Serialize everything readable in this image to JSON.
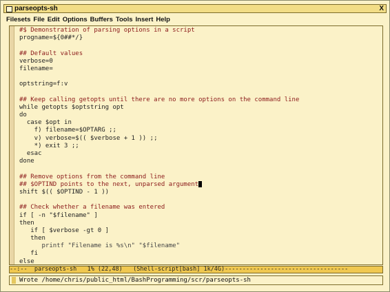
{
  "window": {
    "title": "parseopts-sh",
    "close_label": "X"
  },
  "menu": [
    "Filesets",
    "File",
    "Edit",
    "Options",
    "Buffers",
    "Tools",
    "Insert",
    "Help"
  ],
  "code_lines": [
    [
      {
        "t": "#$ Demonstration of parsing options in a script",
        "c": "cmt"
      }
    ],
    [
      {
        "t": "progname=${0##*/}",
        "c": ""
      }
    ],
    [
      {
        "t": "",
        "c": ""
      }
    ],
    [
      {
        "t": "## Default values",
        "c": "cmt"
      }
    ],
    [
      {
        "t": "verbose=0",
        "c": ""
      }
    ],
    [
      {
        "t": "filename=",
        "c": ""
      }
    ],
    [
      {
        "t": "",
        "c": ""
      }
    ],
    [
      {
        "t": "optstring=f:v",
        "c": ""
      }
    ],
    [
      {
        "t": "",
        "c": ""
      }
    ],
    [
      {
        "t": "## Keep calling getopts until there are no more options on the command line",
        "c": "cmt"
      }
    ],
    [
      {
        "t": "while getopts $optstring opt",
        "c": ""
      }
    ],
    [
      {
        "t": "do",
        "c": ""
      }
    ],
    [
      {
        "t": "  case $opt in",
        "c": ""
      }
    ],
    [
      {
        "t": "    f) filename=$OPTARG ;;",
        "c": ""
      }
    ],
    [
      {
        "t": "    v) verbose=$(( $verbose + 1 )) ;;",
        "c": ""
      }
    ],
    [
      {
        "t": "    *) exit 3 ;;",
        "c": ""
      }
    ],
    [
      {
        "t": "  esac",
        "c": ""
      }
    ],
    [
      {
        "t": "done",
        "c": ""
      }
    ],
    [
      {
        "t": "",
        "c": ""
      }
    ],
    [
      {
        "t": "## Remove options from the command line",
        "c": "cmt"
      }
    ],
    [
      {
        "t": "## $OPTIND points to the next, unparsed argument",
        "c": "cmt"
      }
    ],
    [
      {
        "t": "shift $(( $OPTIND - 1 ))",
        "c": ""
      }
    ],
    [
      {
        "t": "",
        "c": ""
      }
    ],
    [
      {
        "t": "## Check whether a filename was entered",
        "c": "cmt"
      }
    ],
    [
      {
        "t": "if [ -n \"$filename\" ]",
        "c": ""
      }
    ],
    [
      {
        "t": "then",
        "c": ""
      }
    ],
    [
      {
        "t": "   if [ $verbose -gt 0 ]",
        "c": ""
      }
    ],
    [
      {
        "t": "   then",
        "c": ""
      }
    ],
    [
      {
        "t": "      printf \"Filename is %s\\n\" \"$filename\"",
        "c": "str"
      }
    ],
    [
      {
        "t": "   fi",
        "c": ""
      }
    ],
    [
      {
        "t": "else",
        "c": ""
      }
    ]
  ],
  "modeline": "--:--  parseopts-sh   1% (22,48)   (Shell-script[bash] 1k/4G)-----------------------------------",
  "minibuffer": "Wrote /home/chris/public_html/BashProgramming/scr/parseopts-sh"
}
